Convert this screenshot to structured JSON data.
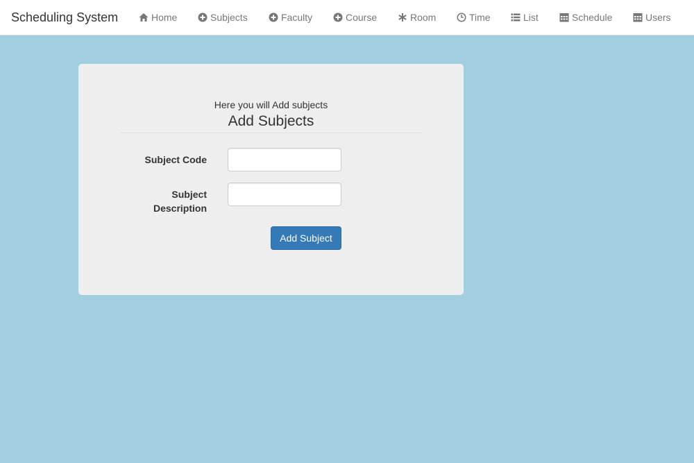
{
  "navbar": {
    "brand": "Scheduling System",
    "items": [
      {
        "label": "Home",
        "icon": "home-icon"
      },
      {
        "label": "Subjects",
        "icon": "plus-circle-icon"
      },
      {
        "label": "Faculty",
        "icon": "plus-circle-icon"
      },
      {
        "label": "Course",
        "icon": "plus-circle-icon"
      },
      {
        "label": "Room",
        "icon": "asterisk-icon"
      },
      {
        "label": "Time",
        "icon": "clock-icon"
      },
      {
        "label": "List",
        "icon": "list-icon"
      },
      {
        "label": "Schedule",
        "icon": "calendar-icon"
      },
      {
        "label": "Users",
        "icon": "calendar-icon"
      }
    ]
  },
  "form": {
    "intro": "Here you will Add subjects",
    "title": "Add Subjects",
    "subject_code_label": "Subject Code",
    "subject_code_value": "",
    "subject_description_label_line1": "Subject",
    "subject_description_label_line2": "Description",
    "subject_description_value": "",
    "submit_label": "Add Subject"
  },
  "colors": {
    "page_background": "#a2cfe0",
    "panel_background": "#eeeeee",
    "primary_button": "#337ab7"
  }
}
